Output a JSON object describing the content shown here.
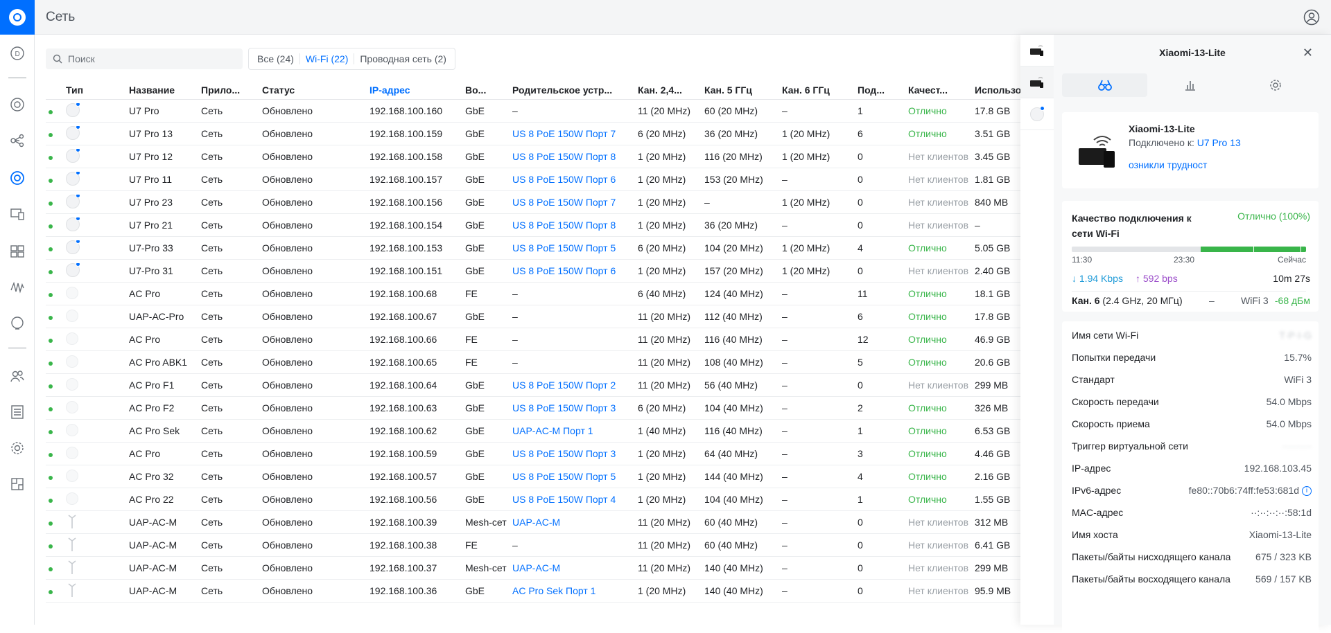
{
  "header": {
    "title": "Сеть"
  },
  "search": {
    "placeholder": "Поиск"
  },
  "filters": [
    {
      "label": "Все (24)"
    },
    {
      "label": "Wi-Fi (22)"
    },
    {
      "label": "Проводная сеть (2)"
    }
  ],
  "columns": {
    "type": "Тип",
    "name": "Название",
    "app": "Прило...",
    "status": "Статус",
    "ip": "IP-адрес",
    "wo": "Во...",
    "parent": "Родительское устр...",
    "ch24": "Кан. 2,4...",
    "ch5": "Кан. 5 ГГц",
    "ch6": "Кан. 6 ГГц",
    "pod": "Под...",
    "quality": "Качест...",
    "usage": "Использо"
  },
  "rows": [
    {
      "name": "U7 Pro",
      "app": "Сеть",
      "status": "Обновлено",
      "ip": "192.168.100.160",
      "wo": "GbE",
      "parent": "–",
      "parent_link": false,
      "ch24": "11 (20 MHz)",
      "ch5": "60 (20 MHz)",
      "ch6": "–",
      "pod": "1",
      "quality": "Отлично",
      "usage": "17.8 GB",
      "icon": "ap"
    },
    {
      "name": "U7 Pro 13",
      "app": "Сеть",
      "status": "Обновлено",
      "ip": "192.168.100.159",
      "wo": "GbE",
      "parent": "US 8 PoE 150W Порт 7",
      "parent_link": true,
      "ch24": "6 (20 MHz)",
      "ch5": "36 (20 MHz)",
      "ch6": "1 (20 MHz)",
      "pod": "6",
      "quality": "Отлично",
      "usage": "3.51 GB",
      "icon": "ap"
    },
    {
      "name": "U7 Pro 12",
      "app": "Сеть",
      "status": "Обновлено",
      "ip": "192.168.100.158",
      "wo": "GbE",
      "parent": "US 8 PoE 150W Порт 8",
      "parent_link": true,
      "ch24": "1 (20 MHz)",
      "ch5": "116 (20 MHz)",
      "ch6": "1 (20 MHz)",
      "pod": "0",
      "quality": "Нет клиентов",
      "usage": "3.45 GB",
      "icon": "ap"
    },
    {
      "name": "U7 Pro 11",
      "app": "Сеть",
      "status": "Обновлено",
      "ip": "192.168.100.157",
      "wo": "GbE",
      "parent": "US 8 PoE 150W Порт 6",
      "parent_link": true,
      "ch24": "1 (20 MHz)",
      "ch5": "153 (20 MHz)",
      "ch6": "–",
      "pod": "0",
      "quality": "Нет клиентов",
      "usage": "1.81 GB",
      "icon": "ap"
    },
    {
      "name": "U7 Pro 23",
      "app": "Сеть",
      "status": "Обновлено",
      "ip": "192.168.100.156",
      "wo": "GbE",
      "parent": "US 8 PoE 150W Порт 7",
      "parent_link": true,
      "ch24": "1 (20 MHz)",
      "ch5": "–",
      "ch6": "1 (20 MHz)",
      "pod": "0",
      "quality": "Нет клиентов",
      "usage": "840 MB",
      "icon": "ap"
    },
    {
      "name": "U7 Pro 21",
      "app": "Сеть",
      "status": "Обновлено",
      "ip": "192.168.100.154",
      "wo": "GbE",
      "parent": "US 8 PoE 150W Порт 8",
      "parent_link": true,
      "ch24": "1 (20 MHz)",
      "ch5": "36 (20 MHz)",
      "ch6": "–",
      "pod": "0",
      "quality": "Нет клиентов",
      "usage": "–",
      "icon": "ap"
    },
    {
      "name": "U7-Pro 33",
      "app": "Сеть",
      "status": "Обновлено",
      "ip": "192.168.100.153",
      "wo": "GbE",
      "parent": "US 8 PoE 150W Порт 5",
      "parent_link": true,
      "ch24": "6 (20 MHz)",
      "ch5": "104 (20 MHz)",
      "ch6": "1 (20 MHz)",
      "pod": "4",
      "quality": "Отлично",
      "usage": "5.05 GB",
      "icon": "ap"
    },
    {
      "name": "U7-Pro 31",
      "app": "Сеть",
      "status": "Обновлено",
      "ip": "192.168.100.151",
      "wo": "GbE",
      "parent": "US 8 PoE 150W Порт 6",
      "parent_link": true,
      "ch24": "1 (20 MHz)",
      "ch5": "157 (20 MHz)",
      "ch6": "1 (20 MHz)",
      "pod": "0",
      "quality": "Нет клиентов",
      "usage": "2.40 GB",
      "icon": "ap"
    },
    {
      "name": "AC Pro",
      "app": "Сеть",
      "status": "Обновлено",
      "ip": "192.168.100.68",
      "wo": "FE",
      "parent": "–",
      "parent_link": false,
      "ch24": "6 (40 MHz)",
      "ch5": "124 (40 MHz)",
      "ch6": "–",
      "pod": "11",
      "quality": "Отлично",
      "usage": "18.1 GB",
      "icon": "flat"
    },
    {
      "name": "UAP-AC-Pro",
      "app": "Сеть",
      "status": "Обновлено",
      "ip": "192.168.100.67",
      "wo": "GbE",
      "parent": "–",
      "parent_link": false,
      "ch24": "11 (20 MHz)",
      "ch5": "112 (40 MHz)",
      "ch6": "–",
      "pod": "6",
      "quality": "Отлично",
      "usage": "17.8 GB",
      "icon": "flat"
    },
    {
      "name": "AC Pro",
      "app": "Сеть",
      "status": "Обновлено",
      "ip": "192.168.100.66",
      "wo": "FE",
      "parent": "–",
      "parent_link": false,
      "ch24": "11 (20 MHz)",
      "ch5": "116 (40 MHz)",
      "ch6": "–",
      "pod": "12",
      "quality": "Отлично",
      "usage": "46.9 GB",
      "icon": "flat"
    },
    {
      "name": "AC Pro ABK1",
      "app": "Сеть",
      "status": "Обновлено",
      "ip": "192.168.100.65",
      "wo": "FE",
      "parent": "–",
      "parent_link": false,
      "ch24": "11 (20 MHz)",
      "ch5": "108 (40 MHz)",
      "ch6": "–",
      "pod": "5",
      "quality": "Отлично",
      "usage": "20.6 GB",
      "icon": "flat"
    },
    {
      "name": "AC Pro F1",
      "app": "Сеть",
      "status": "Обновлено",
      "ip": "192.168.100.64",
      "wo": "GbE",
      "parent": "US 8 PoE 150W Порт 2",
      "parent_link": true,
      "ch24": "11 (20 MHz)",
      "ch5": "56 (40 MHz)",
      "ch6": "–",
      "pod": "0",
      "quality": "Нет клиентов",
      "usage": "299 MB",
      "icon": "flat"
    },
    {
      "name": "AC Pro F2",
      "app": "Сеть",
      "status": "Обновлено",
      "ip": "192.168.100.63",
      "wo": "GbE",
      "parent": "US 8 PoE 150W Порт 3",
      "parent_link": true,
      "ch24": "6 (20 MHz)",
      "ch5": "104 (40 MHz)",
      "ch6": "–",
      "pod": "2",
      "quality": "Отлично",
      "usage": "326 MB",
      "icon": "flat"
    },
    {
      "name": "AC Pro Sek",
      "app": "Сеть",
      "status": "Обновлено",
      "ip": "192.168.100.62",
      "wo": "GbE",
      "parent": "UAP-AC-M Порт 1",
      "parent_link": true,
      "ch24": "1 (40 MHz)",
      "ch5": "116 (40 MHz)",
      "ch6": "–",
      "pod": "1",
      "quality": "Отлично",
      "usage": "6.53 GB",
      "icon": "flat"
    },
    {
      "name": "AC Pro",
      "app": "Сеть",
      "status": "Обновлено",
      "ip": "192.168.100.59",
      "wo": "GbE",
      "parent": "US 8 PoE 150W Порт 3",
      "parent_link": true,
      "ch24": "1 (20 MHz)",
      "ch5": "64 (40 MHz)",
      "ch6": "–",
      "pod": "3",
      "quality": "Отлично",
      "usage": "4.46 GB",
      "icon": "flat"
    },
    {
      "name": "AC Pro 32",
      "app": "Сеть",
      "status": "Обновлено",
      "ip": "192.168.100.57",
      "wo": "GbE",
      "parent": "US 8 PoE 150W Порт 5",
      "parent_link": true,
      "ch24": "1 (20 MHz)",
      "ch5": "144 (40 MHz)",
      "ch6": "–",
      "pod": "4",
      "quality": "Отлично",
      "usage": "2.16 GB",
      "icon": "flat"
    },
    {
      "name": "AC Pro 22",
      "app": "Сеть",
      "status": "Обновлено",
      "ip": "192.168.100.56",
      "wo": "GbE",
      "parent": "US 8 PoE 150W Порт 4",
      "parent_link": true,
      "ch24": "1 (20 MHz)",
      "ch5": "104 (40 MHz)",
      "ch6": "–",
      "pod": "1",
      "quality": "Отлично",
      "usage": "1.55 GB",
      "icon": "flat"
    },
    {
      "name": "UAP-AC-M",
      "app": "Сеть",
      "status": "Обновлено",
      "ip": "192.168.100.39",
      "wo": "Mesh-сет",
      "parent": "UAP-AC-M",
      "parent_link": true,
      "ch24": "11 (20 MHz)",
      "ch5": "60 (40 MHz)",
      "ch6": "–",
      "pod": "0",
      "quality": "Нет клиентов",
      "usage": "312 MB",
      "icon": "mesh"
    },
    {
      "name": "UAP-AC-M",
      "app": "Сеть",
      "status": "Обновлено",
      "ip": "192.168.100.38",
      "wo": "FE",
      "parent": "–",
      "parent_link": false,
      "ch24": "11 (20 MHz)",
      "ch5": "60 (40 MHz)",
      "ch6": "–",
      "pod": "0",
      "quality": "Нет клиентов",
      "usage": "6.41 GB",
      "icon": "mesh"
    },
    {
      "name": "UAP-AC-M",
      "app": "Сеть",
      "status": "Обновлено",
      "ip": "192.168.100.37",
      "wo": "Mesh-сет",
      "parent": "UAP-AC-M",
      "parent_link": true,
      "ch24": "11 (20 MHz)",
      "ch5": "140 (40 MHz)",
      "ch6": "–",
      "pod": "0",
      "quality": "Нет клиентов",
      "usage": "299 MB",
      "icon": "mesh"
    },
    {
      "name": "UAP-AC-M",
      "app": "Сеть",
      "status": "Обновлено",
      "ip": "192.168.100.36",
      "wo": "GbE",
      "parent": "AC Pro Sek Порт 1",
      "parent_link": true,
      "ch24": "1 (20 MHz)",
      "ch5": "140 (40 MHz)",
      "ch6": "–",
      "pod": "0",
      "quality": "Нет клиентов",
      "usage": "95.9 MB",
      "icon": "mesh"
    }
  ],
  "panel": {
    "title": "Xiaomi-13-Lite",
    "device_name": "Xiaomi-13-Lite",
    "connected_label": "Подключено к:",
    "connected_to": "U7 Pro 13",
    "trouble_link": "озникли трудност",
    "quality": {
      "title": "Качество подключения к сети Wi-Fi",
      "value": "Отлично (100%)",
      "level_fraction": 0.45,
      "times": [
        "11:30",
        "23:30",
        "Сейчас"
      ],
      "down": "↓ 1.94 Kbps",
      "up": "↑ 592 bps",
      "duration": "10m 27s",
      "channel_bold": "Кан. 6",
      "channel_detail": "(2.4 GHz, 20 МГц)",
      "dash": "–",
      "standard": "WiFi 3",
      "signal": "-68 дБм"
    },
    "details": [
      {
        "k": "Имя сети Wi-Fi",
        "v": "T·P·I·G",
        "blur": true
      },
      {
        "k": "Попытки передачи",
        "v": "15.7%",
        "blur": false
      },
      {
        "k": "Стандарт",
        "v": "WiFi 3",
        "blur": false
      },
      {
        "k": "Скорость передачи",
        "v": "54.0 Mbps",
        "blur": false
      },
      {
        "k": "Скорость приема",
        "v": "54.0 Mbps",
        "blur": false
      },
      {
        "k": "Триггер виртуальной сети",
        "v": "·········",
        "blur": true
      },
      {
        "k": "IP-адрес",
        "v": "192.168.103.45",
        "blur": false
      },
      {
        "k": "IPv6-адрес",
        "v": "fe80::70b6:74ff:fe53:681d",
        "blur": false,
        "info": true
      },
      {
        "k": "MAC-адрес",
        "v": "··:··:··:··:58:1d",
        "blur": false
      },
      {
        "k": "Имя хоста",
        "v": "Xiaomi-13-Lite",
        "blur": false
      },
      {
        "k": "Пакеты/байты нисходящего канала",
        "v": "675 / 323 KB",
        "blur": false
      },
      {
        "k": "Пакеты/байты восходящего канала",
        "v": "569 / 157 KB",
        "blur": false
      }
    ]
  }
}
